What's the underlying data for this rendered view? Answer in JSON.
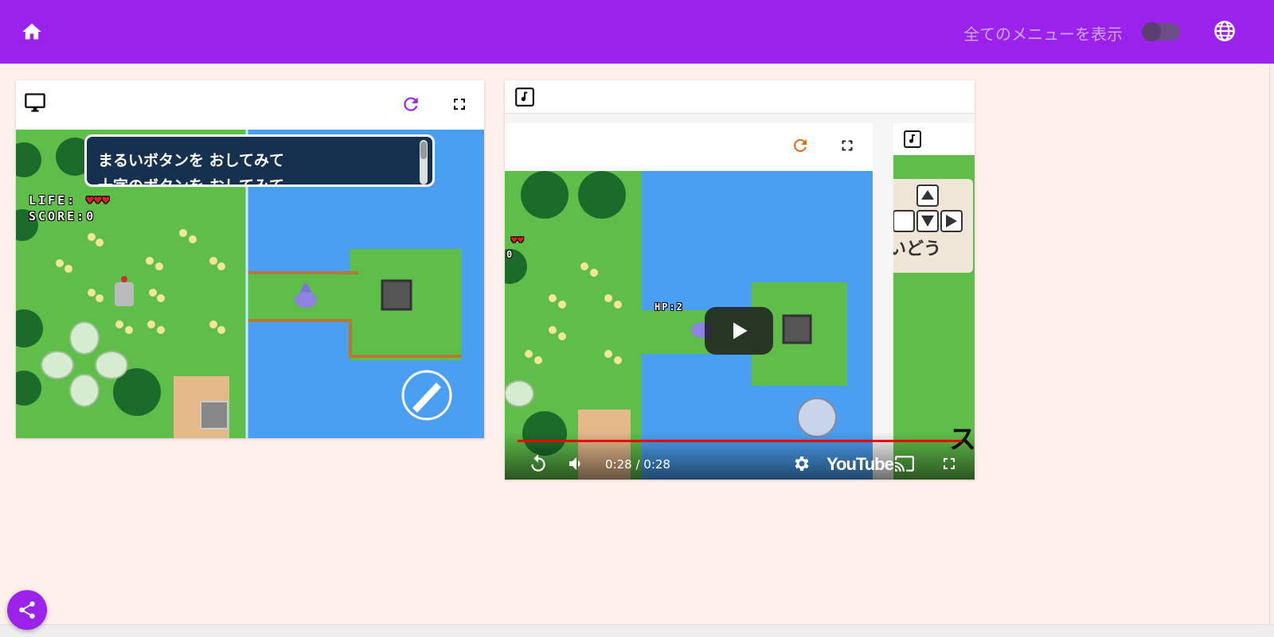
{
  "appbar": {
    "menu_toggle_label": "全てのメニューを表示",
    "toggle_on": false,
    "home_icon": "home-icon",
    "language_icon": "globe-icon",
    "color": "#9b22eb"
  },
  "game_card": {
    "header_icon": "monitor-icon",
    "reload_icon": "reload-icon",
    "fullscreen_icon": "fullscreen-icon",
    "message_lines": [
      "まるいボタンを おしてみて",
      "十字のボタンを おしてみて"
    ],
    "hud_life_label": "LIFE:",
    "hud_score_label": "SCORE:",
    "hud_score_value": "0",
    "hud_lives": 3
  },
  "music_card": {
    "header_icon": "music-note-icon",
    "inner_reload_icon": "reload-icon",
    "inner_fullscreen_icon": "fullscreen-icon",
    "inner_hud_score": "0",
    "enemy_hp_label": "HP:2",
    "side_icon": "music-note-icon",
    "side_text": "いどう",
    "side_partial_text": "ス",
    "video": {
      "time": "0:28 / 0:28",
      "logo": "YouTube",
      "progress": 1.0,
      "progress_color": "#ee0000"
    }
  },
  "share": {
    "icon": "share-icon"
  }
}
